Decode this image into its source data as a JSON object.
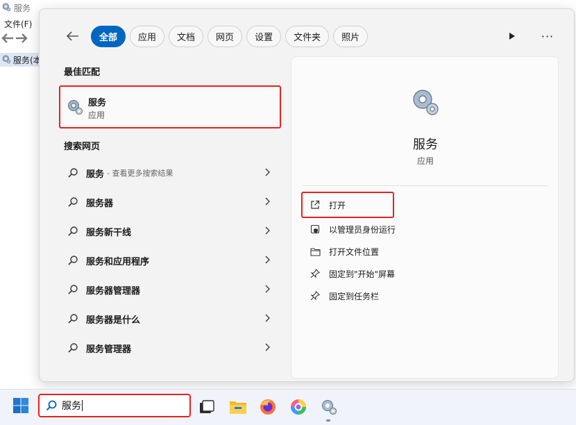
{
  "background_window": {
    "title": "服务",
    "menu_file": "文件(F)",
    "tree_item": "服务(本"
  },
  "search_panel": {
    "filters": [
      "全部",
      "应用",
      "文档",
      "网页",
      "设置",
      "文件夹",
      "照片"
    ],
    "active_filter": "全部",
    "more_label": "···",
    "best_match_title": "最佳匹配",
    "best_match": {
      "name": "服务",
      "type": "应用"
    },
    "web_title": "搜索网页",
    "web_results": [
      {
        "label": "服务",
        "suffix": "- 查看更多搜索结果"
      },
      {
        "label": "服务器",
        "suffix": ""
      },
      {
        "label": "服务新干线",
        "suffix": ""
      },
      {
        "label": "服务和应用程序",
        "suffix": ""
      },
      {
        "label": "服务器管理器",
        "suffix": ""
      },
      {
        "label": "服务器是什么",
        "suffix": ""
      },
      {
        "label": "服务管理器",
        "suffix": ""
      }
    ],
    "details": {
      "name": "服务",
      "type": "应用",
      "actions": {
        "open": "打开",
        "run_as_admin": "以管理员身份运行",
        "open_location": "打开文件位置",
        "pin_start": "固定到\"开始\"屏幕",
        "pin_taskbar": "固定到任务栏"
      }
    }
  },
  "taskbar": {
    "search_value": "服务",
    "apps": [
      "task-view-icon",
      "file-explorer-icon",
      "firefox-icon",
      "chrome-like-icon",
      "services-gear-icon"
    ]
  },
  "colors": {
    "accent": "#0067c0",
    "highlight_border": "#e8221b"
  }
}
